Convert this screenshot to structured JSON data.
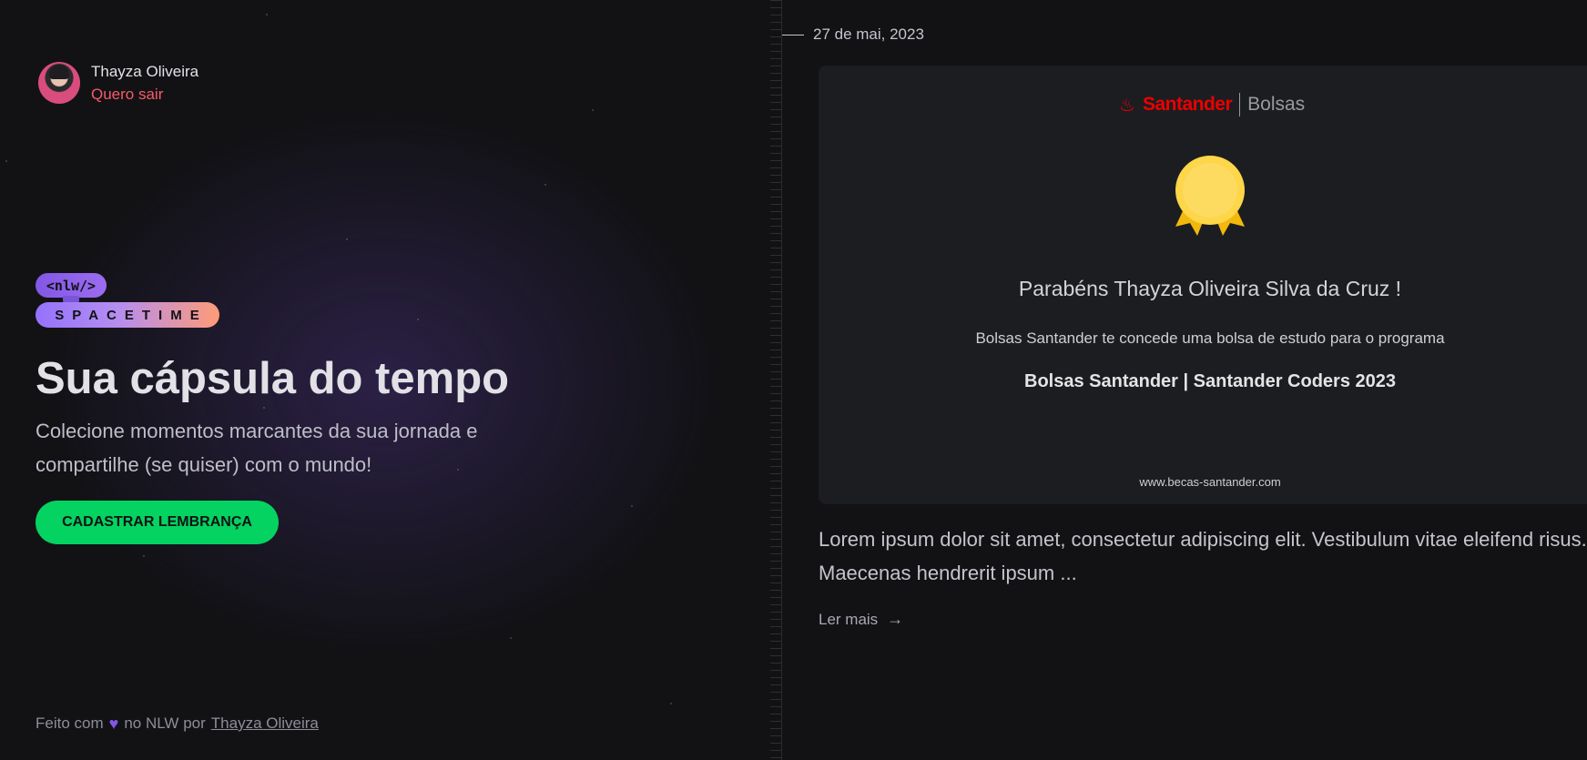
{
  "profile": {
    "name": "Thayza Oliveira",
    "logout_label": "Quero sair"
  },
  "logo": {
    "top_text": "<nlw/>",
    "bottom_text": "SPACETIME"
  },
  "hero": {
    "title": "Sua cápsula do tempo",
    "description": "Colecione momentos marcantes da sua jornada e compartilhe (se quiser) com o mundo!",
    "cta_label": "CADASTRAR LEMBRANÇA"
  },
  "footer": {
    "prefix": "Feito com",
    "heart_icon": "heart-icon",
    "middle": "no NLW por",
    "author": "Thayza Oliveira"
  },
  "memory": {
    "date": "27 de mai, 2023",
    "image": {
      "brand": "Santander",
      "brand_sub": "Bolsas",
      "title": "Parabéns Thayza Oliveira Silva da Cruz !",
      "subtitle": "Bolsas Santander te concede uma bolsa de estudo para o programa",
      "program": "Bolsas Santander | Santander Coders 2023",
      "url": "www.becas-santander.com"
    },
    "excerpt": "Lorem ipsum dolor sit amet, consectetur adipiscing elit. Vestibulum vitae eleifend risus. Maecenas hendrerit ipsum ...",
    "read_more_label": "Ler mais"
  },
  "colors": {
    "accent_green": "#04d361",
    "logout_red": "#f75a68",
    "purple": "#8257e5",
    "background": "#121215"
  }
}
